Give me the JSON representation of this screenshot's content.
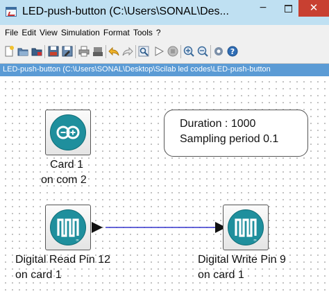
{
  "window": {
    "title": "LED-push-button (C:\\Users\\SONAL\\Des...",
    "minimize_glyph": "−",
    "close_glyph": "✕"
  },
  "menu": {
    "items": [
      "File",
      "Edit",
      "View",
      "Simulation",
      "Format",
      "Tools",
      "?"
    ]
  },
  "toolbar": {
    "icons": [
      "new-diagram-icon",
      "open-icon",
      "open-in-scilab-icon",
      "save-icon",
      "save-as-icon",
      "print-icon",
      "export-icon",
      "undo-icon",
      "redo-icon",
      "fit-diagram-icon",
      "start-icon",
      "stop-icon",
      "zoom-in-icon",
      "zoom-out-icon",
      "xcos-demos-icon",
      "help-icon"
    ]
  },
  "path": {
    "text": "LED-push-button (C:\\Users\\SONAL\\Desktop\\Scilab led codes\\LED-push-button"
  },
  "diagram": {
    "card_block": {
      "line1": "Card 1",
      "line2": "on com 2"
    },
    "read_block": {
      "line1": "Digital Read Pin 12",
      "line2": "on card 1"
    },
    "write_block": {
      "line1": "Digital Write Pin 9",
      "line2": "on card 1"
    },
    "params": {
      "duration": "Duration : 1000",
      "sampling": "Sampling period 0.1"
    },
    "colors": {
      "block_teal": "#1f8f9d",
      "link": "#3333cc",
      "path_bar": "#5b9bd5"
    }
  }
}
